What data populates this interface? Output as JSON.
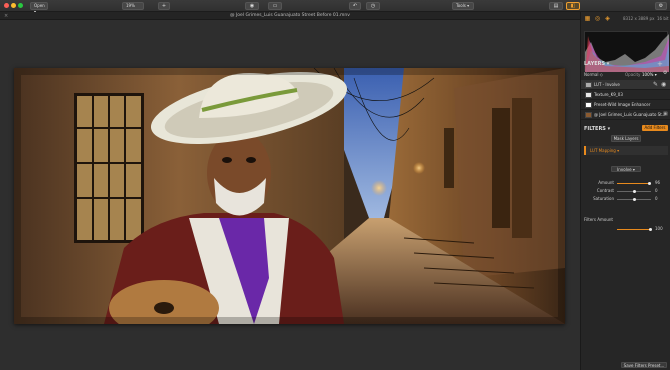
{
  "toolbar": {
    "open_label": "Open ▾",
    "zoom_label": "19%",
    "zoom_plus": "+",
    "tools_label": "Tools ▾"
  },
  "tab": {
    "title": "@ Joel Grimes_Luis Guanajuato Street Before 01.mnv",
    "close": "×"
  },
  "panel": {
    "dims": "8312 x 3889 px",
    "dims_extra": "16 bit",
    "layers_title": "LAYERS ▾",
    "layers_add": "+",
    "blend_mode": "Normal ◇",
    "opacity_label": "Opacity",
    "opacity_value": "100% ▾",
    "lut_layer": "LUT - Involve",
    "texture_layer": "Texture_K9_03",
    "preset_layer": "Preset-Wild Image Enhancer",
    "photo_layer": "@ Joel Grimes_Luis Guanajuato St...",
    "filters_title": "FILTERS ▾",
    "add_filters": "Add Filters",
    "mask_label": "Mask Layers",
    "lut_filter_title": "LUT Mapping ▾",
    "lut_select": "Involve ▾",
    "sliders": [
      {
        "label": "Amount",
        "value": "96"
      },
      {
        "label": "Contrast",
        "value": "0"
      },
      {
        "label": "Saturation",
        "value": "0"
      }
    ],
    "filters_amount": {
      "label": "Filters Amount",
      "value": "100"
    },
    "save_preset": "Save Filters Preset..."
  }
}
